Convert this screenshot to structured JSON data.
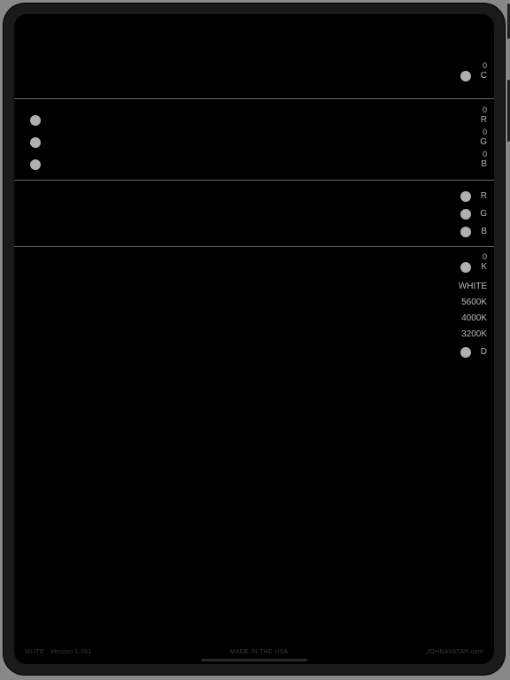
{
  "section_c": {
    "value": "0",
    "label": "C"
  },
  "section_rgb_sliders": {
    "r": {
      "value": "0",
      "label": "R"
    },
    "g": {
      "value": "0",
      "label": "G"
    },
    "b": {
      "value": "0",
      "label": "B"
    }
  },
  "section_rgb_toggles": {
    "r": {
      "label": "R"
    },
    "g": {
      "label": "G"
    },
    "b": {
      "label": "B"
    }
  },
  "section_k": {
    "value": "0",
    "label": "K",
    "presets": {
      "white": "WHITE",
      "p5600": "5600K",
      "p4000": "4000K",
      "p3200": "3200K"
    },
    "d": {
      "label": "D"
    }
  },
  "footer": {
    "left_app": "MLITE",
    "left_version": "Version 1.0b1",
    "center": "MADE IN THE USA",
    "right": "JOHNAVATAR.com"
  }
}
